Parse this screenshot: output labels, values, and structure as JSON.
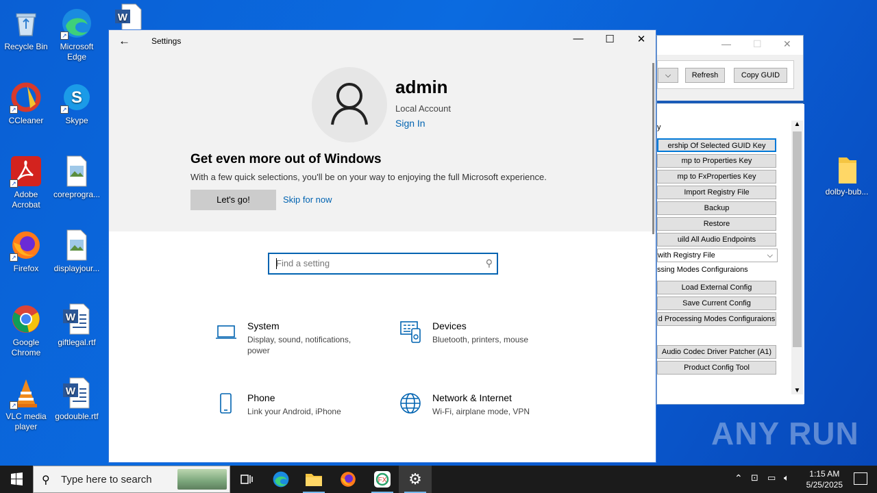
{
  "desktop": {
    "icons": [
      {
        "label": "Recycle Bin"
      },
      {
        "label": "Microsoft Edge"
      },
      {
        "label": "CCleaner"
      },
      {
        "label": "Skype"
      },
      {
        "label": "Adobe Acrobat"
      },
      {
        "label": "coreprogra..."
      },
      {
        "label": "Firefox"
      },
      {
        "label": "displayjour..."
      },
      {
        "label": "Google Chrome"
      },
      {
        "label": "giftlegal.rtf"
      },
      {
        "label": "VLC media player"
      },
      {
        "label": "godouble.rtf"
      }
    ],
    "folder_label": "dolby-bub...",
    "watermark": "ANY RUN"
  },
  "bg_window": {
    "refresh_label": "Refresh",
    "copy_guid_label": "Copy GUID",
    "buttons": [
      "ership Of Selected GUID Key",
      "mp to Properties Key",
      "mp to FxProperties Key",
      "Import Registry File",
      "Backup",
      "Restore",
      "uild All Audio Endpoints"
    ],
    "combo_text": "with Registry File",
    "section_label": "ssing Modes Configuraions",
    "buttons2": [
      "Load External Config",
      "Save Current Config",
      "d Processing Modes Configuraions"
    ],
    "buttons3": [
      "Audio Codec Driver Patcher (A1)",
      "Product Config Tool"
    ],
    "panel_label": "y"
  },
  "settings": {
    "title": "Settings",
    "username": "admin",
    "account_type": "Local Account",
    "sign_in": "Sign In",
    "promo_heading": "Get even more out of Windows",
    "promo_text": "With a few quick selections, you'll be on your way to enjoying the full Microsoft experience.",
    "lets_go": "Let's go!",
    "skip": "Skip for now",
    "search_placeholder": "Find a setting",
    "categories": [
      {
        "title": "System",
        "desc": "Display, sound, notifications, power",
        "icon": "laptop-icon"
      },
      {
        "title": "Devices",
        "desc": "Bluetooth, printers, mouse",
        "icon": "keyboard-icon"
      },
      {
        "title": "Phone",
        "desc": "Link your Android, iPhone",
        "icon": "phone-icon"
      },
      {
        "title": "Network & Internet",
        "desc": "Wi-Fi, airplane mode, VPN",
        "icon": "globe-icon"
      }
    ],
    "accent": "#0063b1"
  },
  "taskbar": {
    "search_text": "Type here to search",
    "time": "1:15 AM",
    "date": "5/25/2025"
  }
}
